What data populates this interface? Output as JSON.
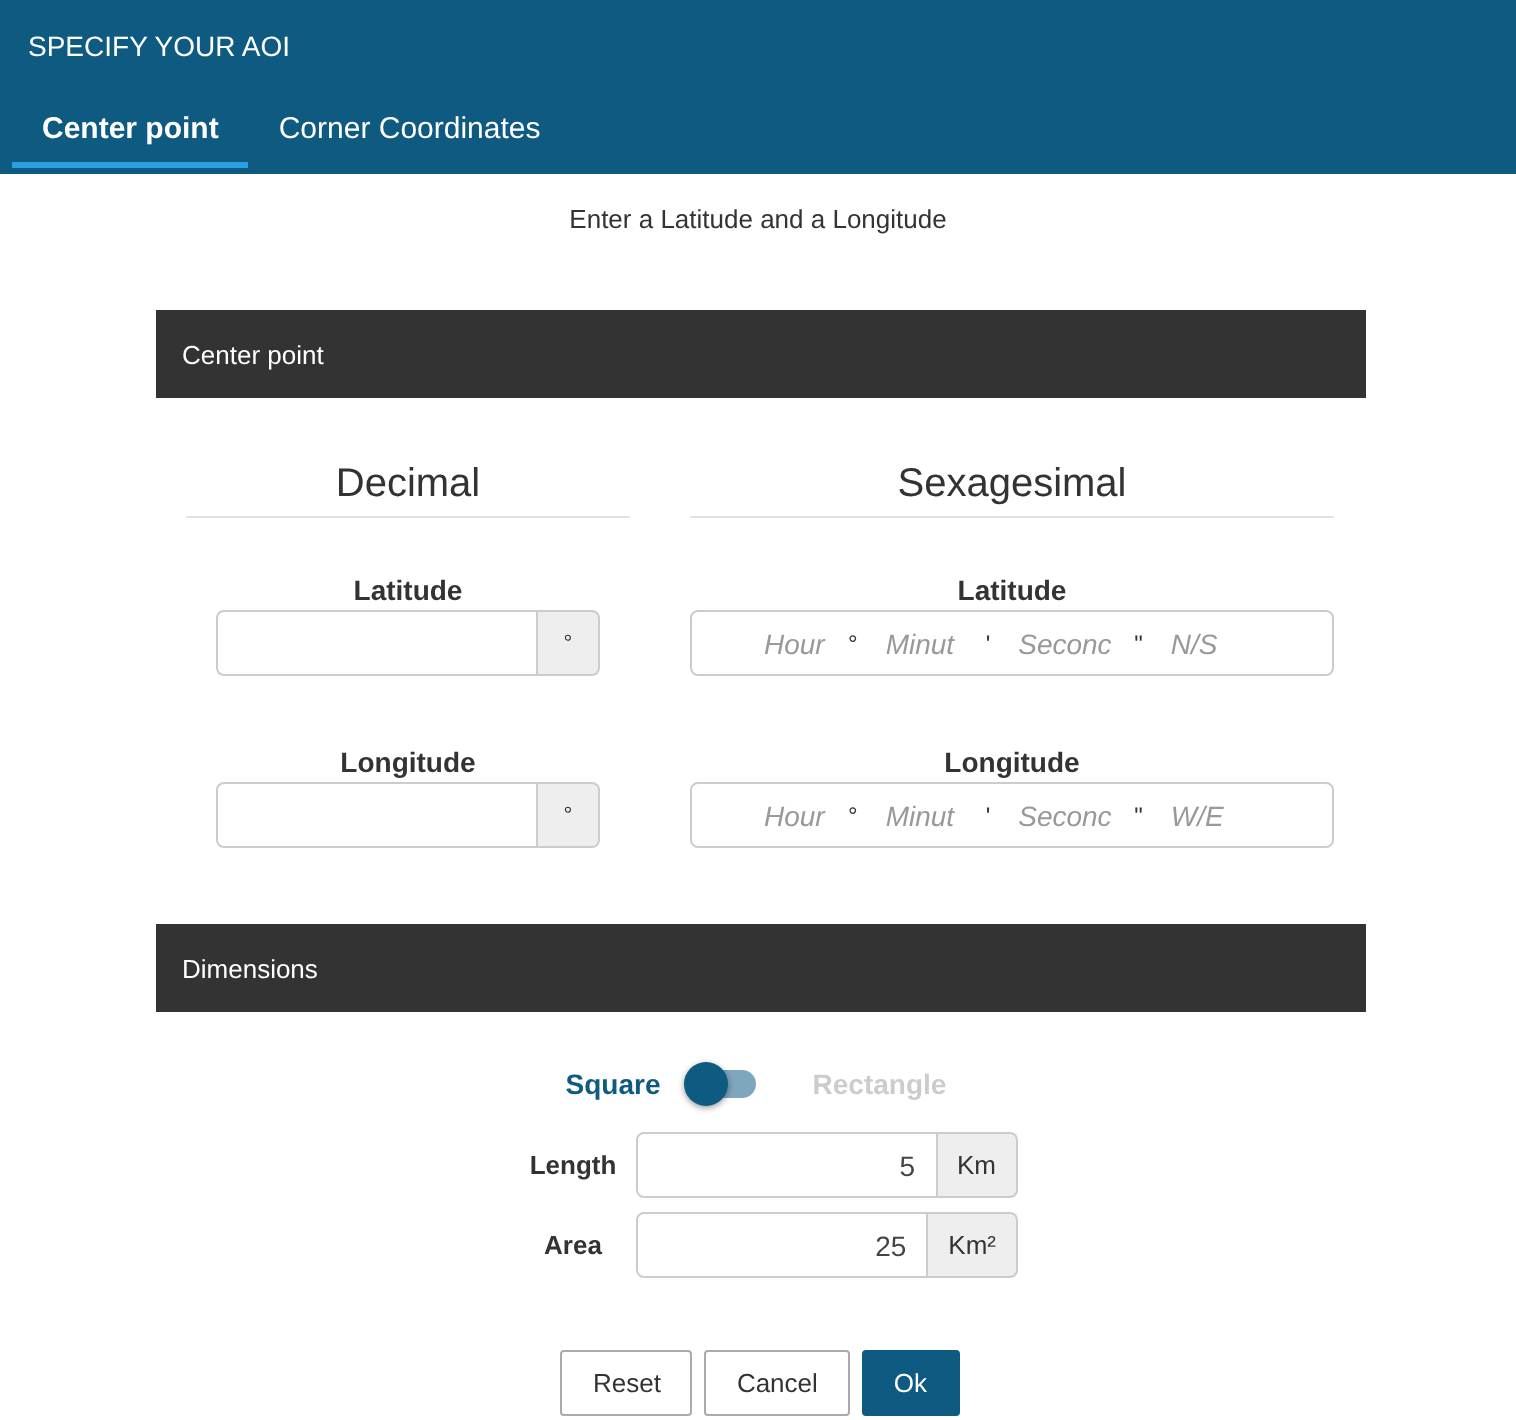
{
  "header": {
    "title": "SPECIFY YOUR AOI"
  },
  "tabs": [
    {
      "label": "Center point",
      "selected": true
    },
    {
      "label": "Corner Coordinates",
      "selected": false
    }
  ],
  "instruction": "Enter a Latitude and a Longitude",
  "center_point": {
    "title": "Center point",
    "columns": [
      {
        "heading": "Decimal",
        "kind": "decimal",
        "fields": [
          {
            "label": "Latitude",
            "unit": "°"
          },
          {
            "label": "Longitude",
            "unit": "°"
          }
        ]
      },
      {
        "heading": "Sexagesimal",
        "kind": "sexagesimal",
        "fields": [
          {
            "label": "Latitude",
            "parts": [
              {
                "placeholder": "Hour",
                "symbol": "°"
              },
              {
                "placeholder": "Minut",
                "symbol": "'"
              },
              {
                "placeholder": "Seconc",
                "symbol": "\""
              },
              {
                "placeholder": "N/S"
              }
            ]
          },
          {
            "label": "Longitude",
            "parts": [
              {
                "placeholder": "Hour",
                "symbol": "°"
              },
              {
                "placeholder": "Minut",
                "symbol": "'"
              },
              {
                "placeholder": "Seconc",
                "symbol": "\""
              },
              {
                "placeholder": "W/E"
              }
            ]
          }
        ]
      }
    ]
  },
  "dimensions": {
    "title": "Dimensions",
    "options": [
      {
        "label": "Square",
        "selected": true
      },
      {
        "label": "Rectangle",
        "selected": false
      }
    ],
    "fields": [
      {
        "label": "Length",
        "value": "5",
        "unit": "Km"
      },
      {
        "label": "Area",
        "value": "25",
        "unit": "Km²"
      }
    ]
  },
  "buttons": [
    {
      "label": "Reset",
      "kind": "default"
    },
    {
      "label": "Cancel",
      "kind": "default"
    },
    {
      "label": "Ok",
      "kind": "primary"
    }
  ]
}
